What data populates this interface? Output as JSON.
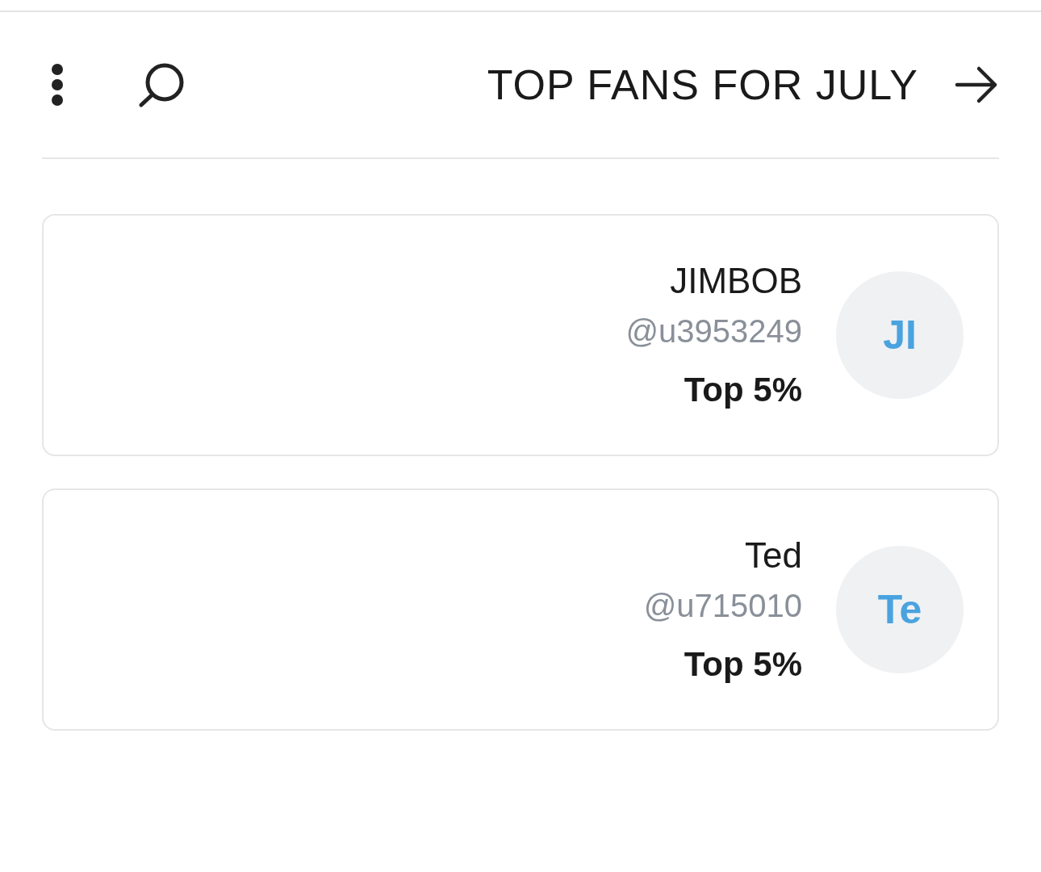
{
  "header": {
    "title": "TOP FANS FOR JULY"
  },
  "fans": [
    {
      "initials": "JI",
      "name": "JIMBOB",
      "handle": "@u3953249",
      "rank": "Top 5%"
    },
    {
      "initials": "Te",
      "name": "Ted",
      "handle": "@u715010",
      "rank": "Top 5%"
    }
  ]
}
